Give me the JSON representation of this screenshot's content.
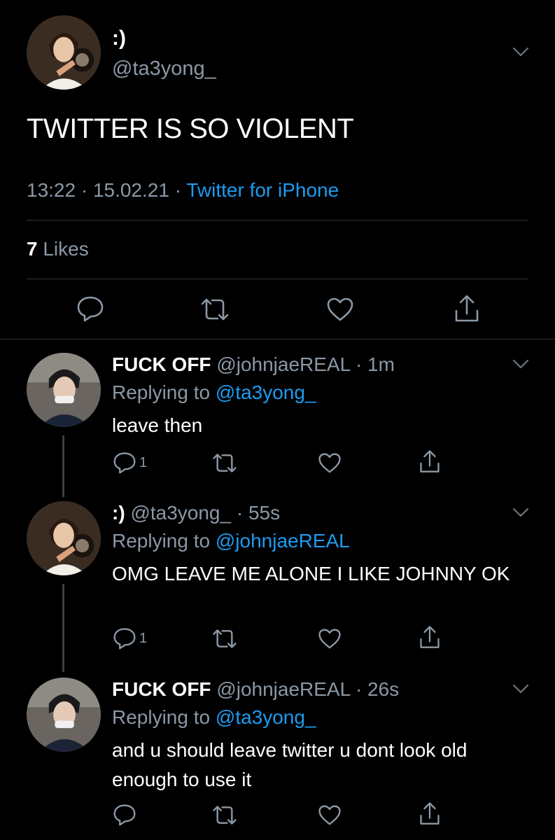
{
  "main_tweet": {
    "display_name": ":)",
    "handle": "@ta3yong_",
    "text": "TWITTER IS SO VIOLENT",
    "time": "13:22 · 15.02.21 · ",
    "source": "Twitter for iPhone",
    "likes_count": "7",
    "likes_label": " Likes"
  },
  "replies": [
    {
      "display_name": "FUCK OFF",
      "handle": "@johnjaeREAL",
      "time": "· 1m",
      "replying_prefix": "Replying to ",
      "replying_to": "@ta3yong_",
      "text": "leave then",
      "reply_count": "1"
    },
    {
      "display_name": ":)",
      "handle": "@ta3yong_",
      "time": "· 55s",
      "replying_prefix": "Replying to ",
      "replying_to": "@johnjaeREAL",
      "text": "OMG LEAVE ME ALONE I LIKE JOHNNY OK",
      "reply_count": "1"
    },
    {
      "display_name": "FUCK OFF",
      "handle": "@johnjaeREAL",
      "time": "· 26s",
      "replying_prefix": "Replying to ",
      "replying_to": "@ta3yong_",
      "text": "and u should leave twitter u dont look old enough to use it",
      "reply_count": ""
    }
  ],
  "colors": {
    "background": "#000000",
    "text_primary": "#ffffff",
    "text_secondary": "#8b98a5",
    "link": "#1d9bf0",
    "divider": "#2f3336"
  },
  "icons": [
    "chevron-down-icon",
    "reply-icon",
    "retweet-icon",
    "like-icon",
    "share-icon"
  ]
}
